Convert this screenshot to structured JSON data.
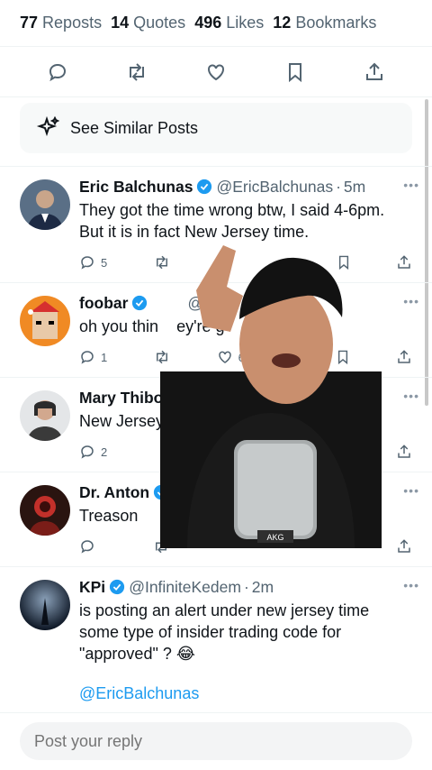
{
  "stats": {
    "reposts_count": "77",
    "reposts_label": "Reposts",
    "quotes_count": "14",
    "quotes_label": "Quotes",
    "likes_count": "496",
    "likes_label": "Likes",
    "bookmarks_count": "12",
    "bookmarks_label": "Bookmarks"
  },
  "similar": {
    "label": "See Similar Posts"
  },
  "posts": [
    {
      "name": "Eric Balchunas",
      "handle": "@EricBalchunas",
      "sep": "·",
      "time": "5m",
      "text": "They got the time wrong btw, I said 4-6pm. But it is in fact New Jersey time.",
      "reply_count": "5",
      "like_count": "",
      "views": "K"
    },
    {
      "name": "foobar",
      "handle": "@foob",
      "text": "oh you thin    ey're g            it?",
      "reply_count": "1",
      "like_count": "6"
    },
    {
      "name": "Mary Thibo",
      "handle": "",
      "text": "New Jersey",
      "reply_count": "2"
    },
    {
      "name": "Dr. Anton",
      "handle": "@a",
      "text": "Treason",
      "reply_count": ""
    },
    {
      "name": "KPi",
      "handle": "@InfiniteKedem",
      "sep": "·",
      "time": "2m",
      "text": "is posting an alert under new jersey time some type of insider trading code for \"approved\" ? 😂",
      "mention": "@EricBalchunas"
    }
  ],
  "reply": {
    "placeholder": "Post your reply"
  },
  "colors": {
    "accent": "#1d9bf0",
    "text": "#0f1419",
    "muted": "#536471"
  },
  "icons": [
    "reply-icon",
    "repost-icon",
    "like-icon",
    "bookmark-icon",
    "share-icon",
    "sparkle-icon",
    "verified-icon",
    "more-icon"
  ]
}
